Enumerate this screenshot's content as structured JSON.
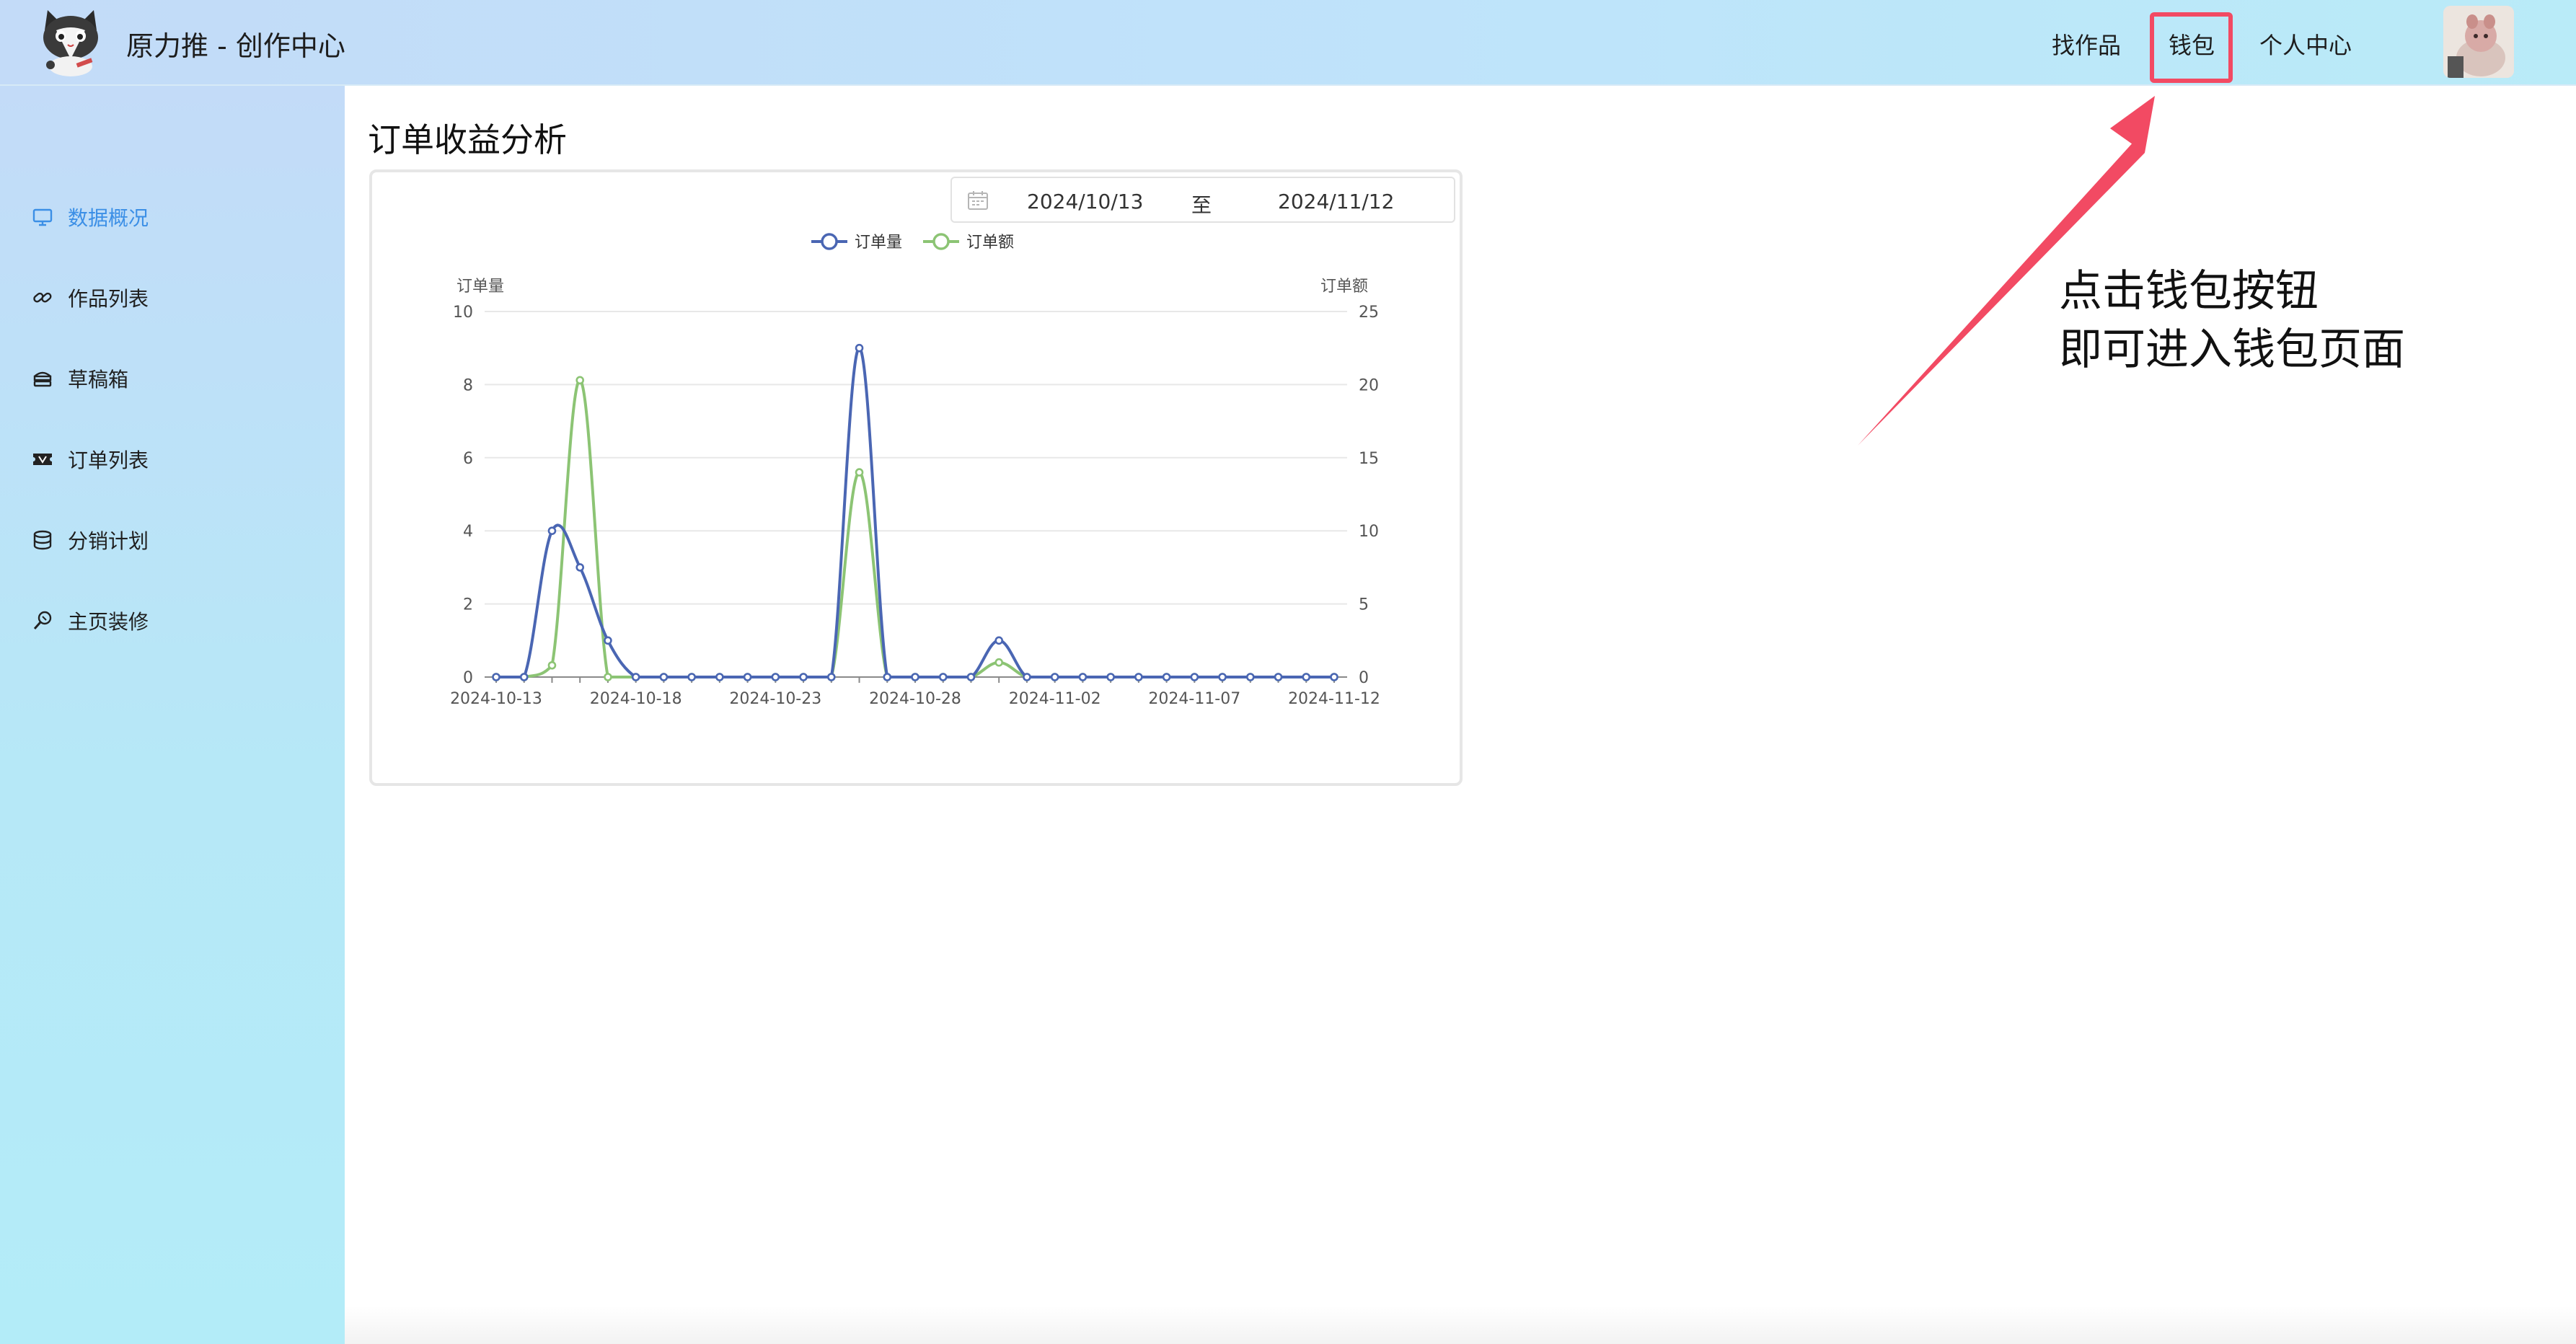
{
  "app": {
    "title": "原力推 - 创作中心"
  },
  "header": {
    "nav": {
      "find_works": "找作品",
      "wallet": "钱包",
      "personal_center": "个人中心"
    }
  },
  "sidebar": {
    "items": [
      {
        "label": "数据概况",
        "icon": "monitor-icon",
        "active": true
      },
      {
        "label": "作品列表",
        "icon": "link-icon",
        "active": false
      },
      {
        "label": "草稿箱",
        "icon": "box-icon",
        "active": false
      },
      {
        "label": "订单列表",
        "icon": "ticket-icon",
        "active": false
      },
      {
        "label": "分销计划",
        "icon": "database-icon",
        "active": false
      },
      {
        "label": "主页装修",
        "icon": "brush-icon",
        "active": false
      }
    ]
  },
  "main": {
    "title": "订单收益分析",
    "date_range": {
      "start": "2024/10/13",
      "separator": "至",
      "end": "2024/11/12"
    }
  },
  "annotation": {
    "line1": "点击钱包按钮",
    "line2": "即可进入钱包页面",
    "color": "#f24a63"
  },
  "chart_data": {
    "type": "line",
    "smooth": true,
    "legend": [
      "订单量",
      "订单额"
    ],
    "legend_position": "top-center",
    "grid": true,
    "x_tick_labels": [
      "2024-10-13",
      "2024-10-18",
      "2024-10-23",
      "2024-10-28",
      "2024-11-02",
      "2024-11-07",
      "2024-11-12"
    ],
    "x": [
      "2024-10-13",
      "2024-10-14",
      "2024-10-15",
      "2024-10-16",
      "2024-10-17",
      "2024-10-18",
      "2024-10-19",
      "2024-10-20",
      "2024-10-21",
      "2024-10-22",
      "2024-10-23",
      "2024-10-24",
      "2024-10-25",
      "2024-10-26",
      "2024-10-27",
      "2024-10-28",
      "2024-10-29",
      "2024-10-30",
      "2024-10-31",
      "2024-11-01",
      "2024-11-02",
      "2024-11-03",
      "2024-11-04",
      "2024-11-05",
      "2024-11-06",
      "2024-11-07",
      "2024-11-08",
      "2024-11-09",
      "2024-11-10",
      "2024-11-11",
      "2024-11-12"
    ],
    "y_left": {
      "label": "订单量",
      "range": [
        0,
        10
      ],
      "ticks": [
        0,
        2,
        4,
        6,
        8,
        10
      ]
    },
    "y_right": {
      "label": "订单额",
      "range": [
        0,
        25
      ],
      "ticks": [
        0,
        5,
        10,
        15,
        20,
        25
      ]
    },
    "series": [
      {
        "name": "订单量",
        "axis": "left",
        "color": "#4a66b3",
        "values": [
          0,
          0,
          4,
          3,
          1,
          0,
          0,
          0,
          0,
          0,
          0,
          0,
          0,
          9,
          0,
          0,
          0,
          0,
          1,
          0,
          0,
          0,
          0,
          0,
          0,
          0,
          0,
          0,
          0,
          0,
          0
        ]
      },
      {
        "name": "订单额",
        "axis": "right",
        "color": "#8cc474",
        "values": [
          0,
          0,
          0.8,
          20.3,
          0,
          0,
          0,
          0,
          0,
          0,
          0,
          0,
          0,
          14,
          0,
          0,
          0,
          0,
          1,
          0,
          0,
          0,
          0,
          0,
          0,
          0,
          0,
          0,
          0,
          0,
          0
        ]
      }
    ]
  }
}
